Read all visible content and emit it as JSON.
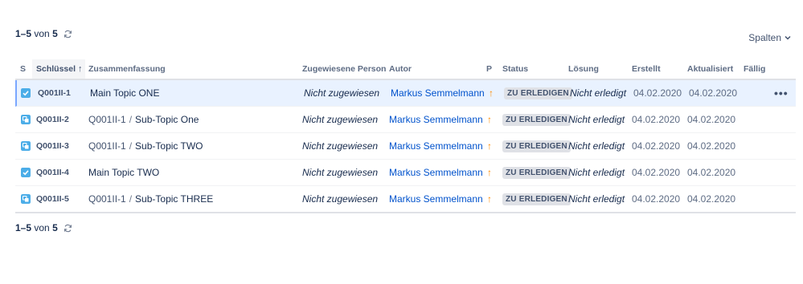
{
  "pagination": {
    "range": "1–5",
    "of": "von",
    "total": "5"
  },
  "columns_button": "Spalten",
  "headers": {
    "type": "S",
    "key": "Schlüssel",
    "summary": "Zusammenfassung",
    "assignee": "Zugewiesene Person",
    "reporter": "Autor",
    "priority": "P",
    "status": "Status",
    "resolution": "Lösung",
    "created": "Erstellt",
    "updated": "Aktualisiert",
    "due": "Fällig"
  },
  "rows": [
    {
      "type_icon": "task-checkbox-icon",
      "key": "Q001II-1",
      "parent": "",
      "summary": "Main Topic ONE",
      "assignee": "Nicht zugewiesen",
      "reporter": "Markus Semmelmann",
      "status": "ZU ERLEDIGEN",
      "resolution": "Nicht erledigt",
      "created": "04.02.2020",
      "updated": "04.02.2020"
    },
    {
      "type_icon": "subtask-icon",
      "key": "Q001II-2",
      "parent": "Q001II-1",
      "summary": "Sub-Topic One",
      "assignee": "Nicht zugewiesen",
      "reporter": "Markus Semmelmann",
      "status": "ZU ERLEDIGEN",
      "resolution": "Nicht erledigt",
      "created": "04.02.2020",
      "updated": "04.02.2020"
    },
    {
      "type_icon": "subtask-icon",
      "key": "Q001II-3",
      "parent": "Q001II-1",
      "summary": "Sub-Topic TWO",
      "assignee": "Nicht zugewiesen",
      "reporter": "Markus Semmelmann",
      "status": "ZU ERLEDIGEN",
      "resolution": "Nicht erledigt",
      "created": "04.02.2020",
      "updated": "04.02.2020"
    },
    {
      "type_icon": "task-checkbox-icon",
      "key": "Q001II-4",
      "parent": "",
      "summary": "Main Topic TWO",
      "assignee": "Nicht zugewiesen",
      "reporter": "Markus Semmelmann",
      "status": "ZU ERLEDIGEN",
      "resolution": "Nicht erledigt",
      "created": "04.02.2020",
      "updated": "04.02.2020"
    },
    {
      "type_icon": "subtask-icon",
      "key": "Q001II-5",
      "parent": "Q001II-1",
      "summary": "Sub-Topic THREE",
      "assignee": "Nicht zugewiesen",
      "reporter": "Markus Semmelmann",
      "status": "ZU ERLEDIGEN",
      "resolution": "Nicht erledigt",
      "created": "04.02.2020",
      "updated": "04.02.2020"
    }
  ],
  "colors": {
    "link": "#0052cc",
    "priority": "#ff8b00",
    "issue_icon": "#4bade8",
    "selected_row": "#e9f2ff"
  }
}
